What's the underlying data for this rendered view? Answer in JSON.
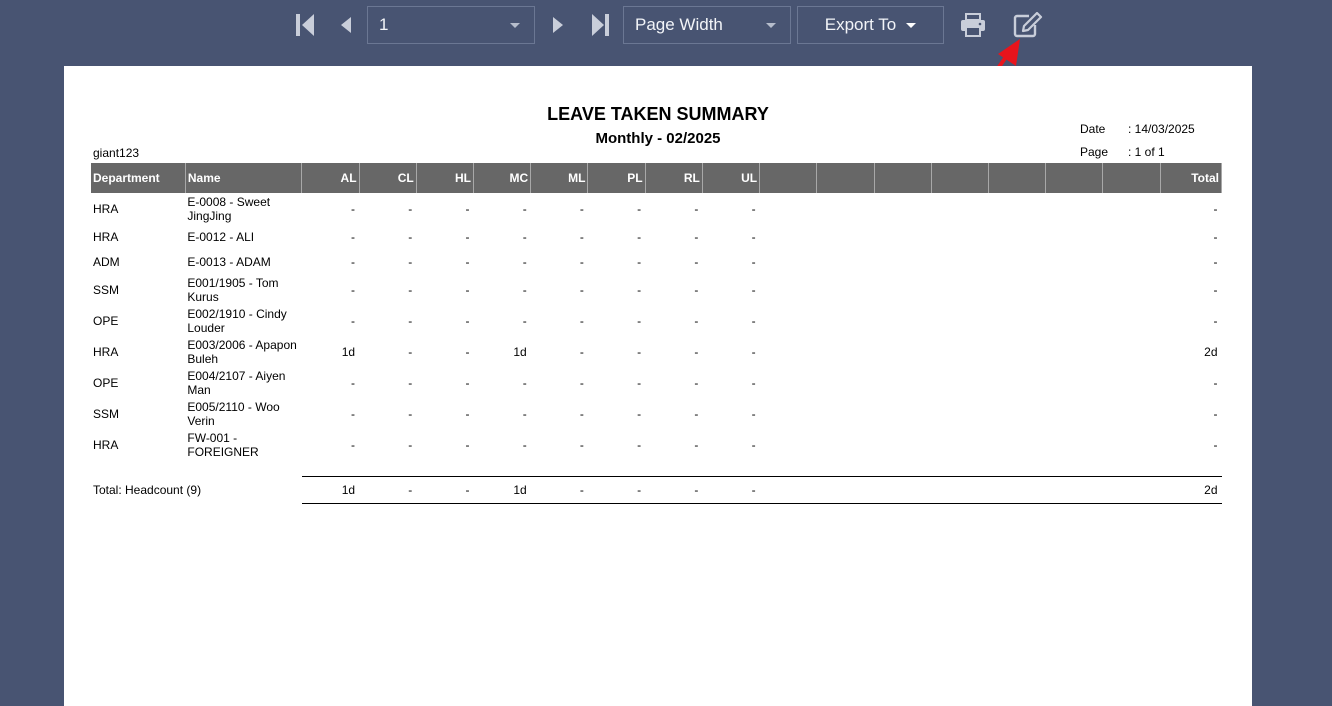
{
  "toolbar": {
    "page_value": "1",
    "zoom_value": "Page Width",
    "export_label": "Export To",
    "icons": [
      "first-page-icon",
      "prev-page-icon",
      "next-page-icon",
      "last-page-icon",
      "print-icon",
      "edit-icon",
      "annotation-arrow-icon"
    ]
  },
  "report": {
    "title": "LEAVE TAKEN SUMMARY",
    "subtitle": "Monthly - 02/2025",
    "user": "giant123",
    "date_label": "Date",
    "date_value": ": 14/03/2025",
    "page_label": "Page",
    "page_value": ": 1 of 1",
    "headers": [
      "Department",
      "Name",
      "AL",
      "CL",
      "HL",
      "MC",
      "ML",
      "PL",
      "RL",
      "UL",
      "",
      "",
      "",
      "",
      "",
      "",
      "",
      "Total"
    ],
    "rows": [
      {
        "dept": "HRA",
        "name": "E-0008 - Sweet JingJing",
        "vals": [
          "-",
          "-",
          "-",
          "-",
          "-",
          "-",
          "-",
          "-"
        ],
        "total": "-"
      },
      {
        "dept": "HRA",
        "name": "E-0012 - ALI",
        "vals": [
          "-",
          "-",
          "-",
          "-",
          "-",
          "-",
          "-",
          "-"
        ],
        "total": "-"
      },
      {
        "dept": "ADM",
        "name": "E-0013 - ADAM",
        "vals": [
          "-",
          "-",
          "-",
          "-",
          "-",
          "-",
          "-",
          "-"
        ],
        "total": "-"
      },
      {
        "dept": "SSM",
        "name": "E001/1905 - Tom Kurus",
        "vals": [
          "-",
          "-",
          "-",
          "-",
          "-",
          "-",
          "-",
          "-"
        ],
        "total": "-"
      },
      {
        "dept": "OPE",
        "name": "E002/1910 - Cindy Louder",
        "vals": [
          "-",
          "-",
          "-",
          "-",
          "-",
          "-",
          "-",
          "-"
        ],
        "total": "-"
      },
      {
        "dept": "HRA",
        "name": "E003/2006 - Apapon Buleh",
        "vals": [
          "1d",
          "-",
          "-",
          "1d",
          "-",
          "-",
          "-",
          "-"
        ],
        "total": "2d"
      },
      {
        "dept": "OPE",
        "name": "E004/2107 - Aiyen Man",
        "vals": [
          "-",
          "-",
          "-",
          "-",
          "-",
          "-",
          "-",
          "-"
        ],
        "total": "-"
      },
      {
        "dept": "SSM",
        "name": "E005/2110 - Woo Verin",
        "vals": [
          "-",
          "-",
          "-",
          "-",
          "-",
          "-",
          "-",
          "-"
        ],
        "total": "-"
      },
      {
        "dept": "HRA",
        "name": "FW-001 - FOREIGNER",
        "vals": [
          "-",
          "-",
          "-",
          "-",
          "-",
          "-",
          "-",
          "-"
        ],
        "total": "-"
      }
    ],
    "total_label": "Total: Headcount (9)",
    "total_vals": [
      "1d",
      "-",
      "-",
      "1d",
      "-",
      "-",
      "-",
      "-"
    ],
    "total_total": "2d"
  }
}
